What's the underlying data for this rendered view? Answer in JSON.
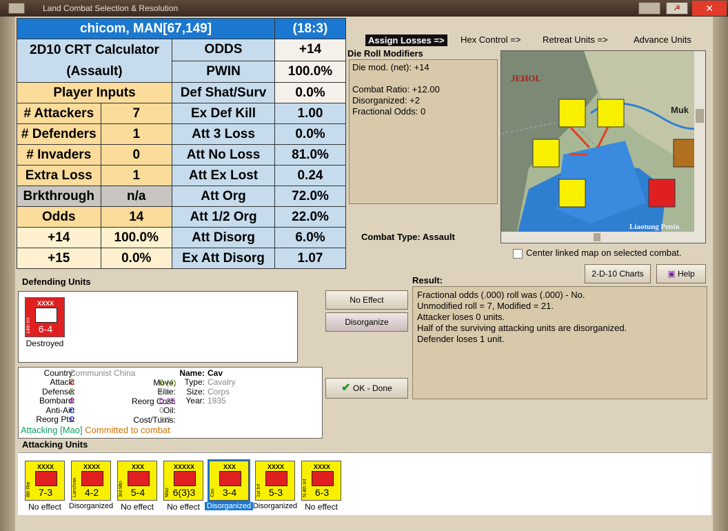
{
  "window": {
    "title": "Land Combat Selection & Resolution"
  },
  "calc": {
    "header_left": "chicom, MAN[67,149]",
    "header_right": "(18:3)",
    "rows": [
      {
        "a": "2D10 CRT Calculator",
        "b": "",
        "c": "ODDS",
        "d": "+14"
      },
      {
        "a": "(Assault)",
        "b": "",
        "c": "PWIN",
        "d": "100.0%"
      },
      {
        "a": "Player Inputs",
        "b": "",
        "c": "Def Shat/Surv",
        "d": "0.0%"
      },
      {
        "a": "# Attackers",
        "b": "7",
        "c": "Ex Def Kill",
        "d": "1.00"
      },
      {
        "a": "# Defenders",
        "b": "1",
        "c": "Att 3 Loss",
        "d": "0.0%"
      },
      {
        "a": "# Invaders",
        "b": "0",
        "c": "Att No Loss",
        "d": "81.0%"
      },
      {
        "a": "Extra Loss",
        "b": "1",
        "c": "Att Ex Lost",
        "d": "0.24"
      },
      {
        "a": "Brkthrough",
        "b": "n/a",
        "c": "Att Org",
        "d": "72.0%"
      },
      {
        "a": "Odds",
        "b": "14",
        "c": "Att 1/2 Org",
        "d": "22.0%"
      },
      {
        "a": "+14",
        "b": "100.0%",
        "c": "Att Disorg",
        "d": "6.0%"
      },
      {
        "a": "+15",
        "b": "0.0%",
        "c": "Ex Att Disorg",
        "d": "1.07"
      }
    ]
  },
  "tabs": [
    {
      "label": "Assign Losses =>"
    },
    {
      "label": "Hex Control =>"
    },
    {
      "label": "Retreat Units =>"
    },
    {
      "label": "Advance Units"
    }
  ],
  "modifiers": {
    "title": "Die Roll Modifiers",
    "lines": [
      "Die mod. (net): +14",
      "",
      "Combat Ratio: +12.00",
      "Disorganized: +2",
      "Fractional Odds: 0"
    ]
  },
  "combat_type": "Combat Type:  Assault",
  "map": {
    "labels": {
      "jehol": "JEHOL",
      "mukden": "Muk",
      "liaotung": "Liaotung Penin"
    }
  },
  "center_map_label": "Center linked map on selected combat.",
  "buttons": {
    "charts": "2-D-10 Charts",
    "help": "Help",
    "no_effect": "No Effect",
    "disorganize": "Disorganize",
    "ok_done": "OK - Done"
  },
  "result": {
    "title": "Result:",
    "lines": [
      "Fractional odds (.000) roll was (.000)  -  No.",
      "Unmodified roll = 7, Modified = 21.",
      "Attacker loses 0 units.",
      "Half of the surviving attacking units are disorganized.",
      "Defender loses 1 unit."
    ]
  },
  "defending": {
    "title": "Defending Units",
    "unit": {
      "size": "XXXX",
      "name": "14th Inf",
      "stat": "6-4",
      "status": "Destroyed"
    }
  },
  "info": {
    "country_label": "Country:",
    "country": "Communist China",
    "attack_label": "Attack:",
    "attack": "3",
    "defense_label": "Defense:",
    "defense": "3",
    "bombard_label": "Bombard:",
    "bombard": "0",
    "antiair_label": "Anti-Air:",
    "antiair": "0",
    "reorgpts_label": "Reorg Pts:",
    "reorgpts": "0",
    "move_label": "Move:",
    "move": "0 (4)",
    "elite_label": "Elite:",
    "elite": "No",
    "reorgcost_label": "Reorg Cost:",
    "reorgcost": "0.25",
    "oil_label": "Oil:",
    "oil": "0",
    "costturns_label": "Cost/Turns:",
    "costturns": "2/3",
    "name_label": "Name:",
    "name": "Cav",
    "type_label": "Type:",
    "type": "Cavalry",
    "size_label": "Size:",
    "size": "Corps",
    "year_label": "Year:",
    "year": "1935",
    "attacking_note": "Attacking [Mao]",
    "committed_note": "Committed to combat"
  },
  "attacking": {
    "title": "Attacking Units",
    "units": [
      {
        "size": "XXXX",
        "name": "8th Rte",
        "stat": "7-3",
        "status": "No effect"
      },
      {
        "size": "XXXX",
        "name": "Lanchow",
        "stat": "4-2",
        "status": "Disorganized"
      },
      {
        "size": "XXX",
        "name": "3rd Mtn",
        "stat": "5-4",
        "status": "No effect"
      },
      {
        "size": "XXXXX",
        "name": "Mao",
        "stat": "6(3)3",
        "status": "No effect"
      },
      {
        "size": "XXX",
        "name": "Cav",
        "stat": "3-4",
        "status": "Disorganized"
      },
      {
        "size": "XXXX",
        "name": "1st Inf",
        "stat": "5-3",
        "status": "Disorganized"
      },
      {
        "size": "XXXX",
        "name": "N 4th Inf",
        "stat": "6-3",
        "status": "No effect"
      }
    ]
  },
  "colors": {
    "accent": "#1b78d0",
    "counter": "#f8f000",
    "enemy": "#e02020"
  }
}
